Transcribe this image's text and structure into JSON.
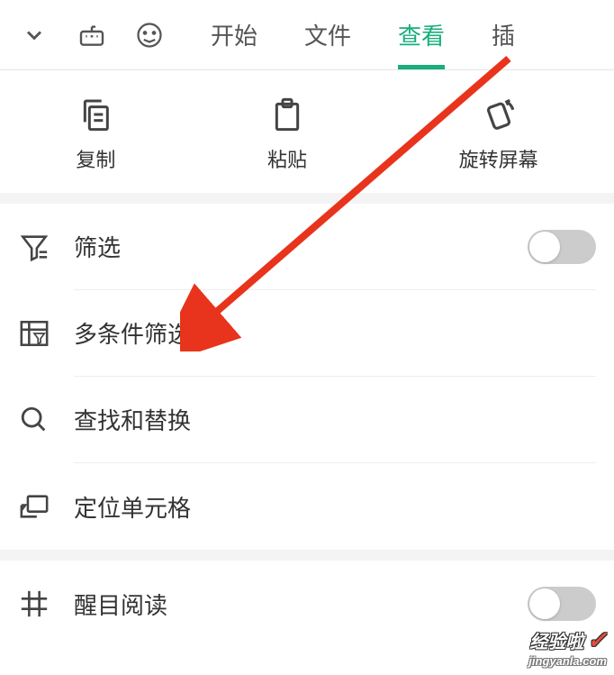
{
  "tabs": {
    "start": "开始",
    "file": "文件",
    "view": "查看",
    "plugin": "插"
  },
  "toolbar": {
    "copy": "复制",
    "paste": "粘贴",
    "rotate": "旋转屏幕"
  },
  "menu": {
    "filter": "筛选",
    "multi_filter": "多条件筛选",
    "find_replace": "查找和替换",
    "locate_cell": "定位单元格",
    "highlight_read": "醒目阅读"
  },
  "watermark": {
    "main": "经验啦",
    "sub": "jingyanla.com"
  }
}
